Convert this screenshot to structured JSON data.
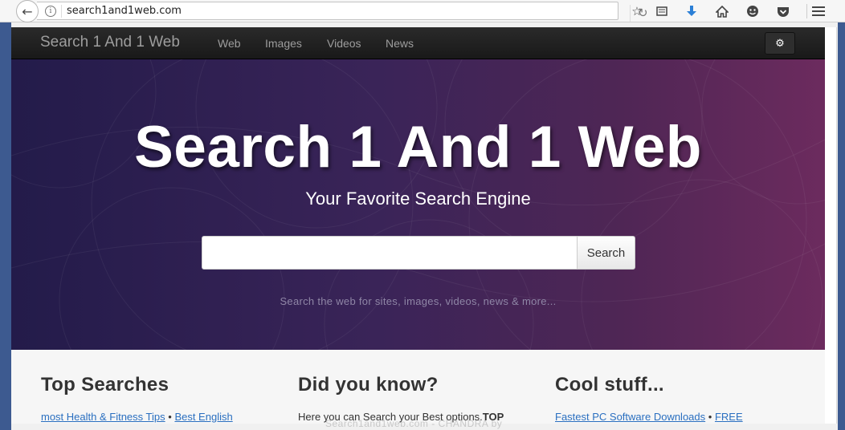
{
  "browser": {
    "url": "search1and1web.com"
  },
  "site": {
    "brand": "Search 1 And 1 Web",
    "nav": [
      "Web",
      "Images",
      "Videos",
      "News"
    ],
    "hero_title": "Search 1 And 1 Web",
    "hero_subtitle": "Your Favorite Search Engine",
    "search_button": "Search",
    "search_value": "",
    "hint": "Search the web for sites, images, videos, news & more...",
    "colors": {
      "hero_left": "#231b4a",
      "hero_right": "#6c2b5e",
      "link": "#2a6fc0"
    }
  },
  "sections": {
    "top_searches": {
      "title": "Top Searches",
      "link1": "most Health & Fitness Tips",
      "sep": "•",
      "link2": "Best English"
    },
    "did_you_know": {
      "title": "Did you know?",
      "text": "Here you can Search your Best options.",
      "bold": "TOP"
    },
    "cool_stuff": {
      "title": "Cool stuff...",
      "link1": "Fastest PC Software Downloads",
      "sep": "•",
      "link2": "FREE"
    }
  },
  "watermark": "Search1and1web.com - CHANDRA by",
  "icons": [
    "back-arrow-icon",
    "info-icon",
    "reload-icon",
    "star-icon",
    "reader-icon",
    "download-icon",
    "home-icon",
    "smiley-icon",
    "pocket-icon",
    "menu-icon",
    "gear-icon"
  ]
}
